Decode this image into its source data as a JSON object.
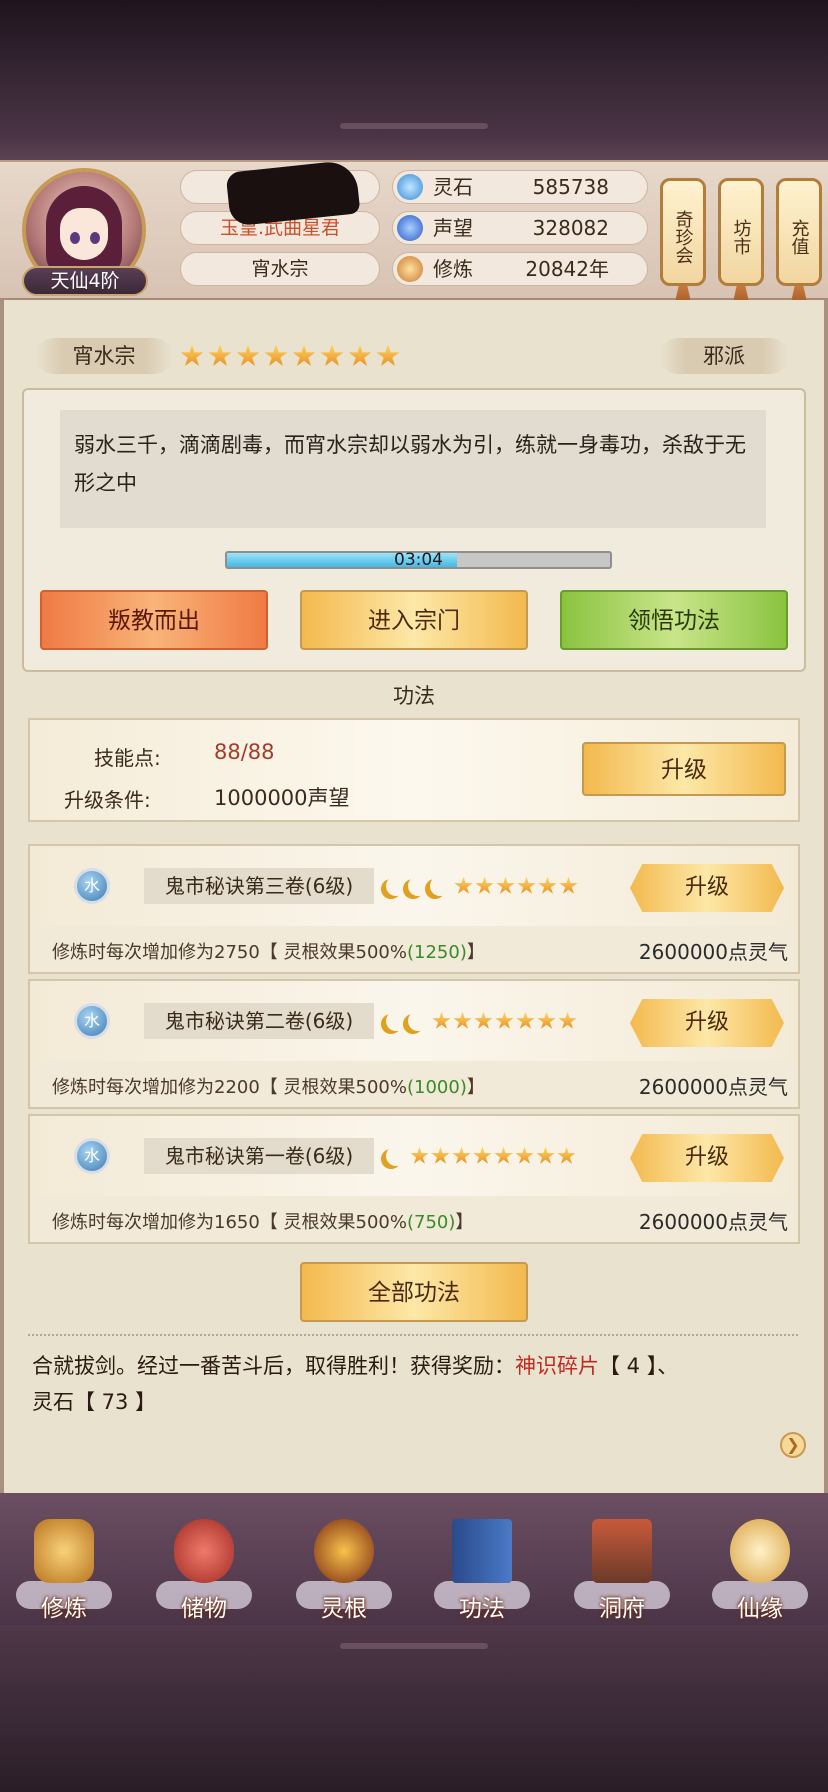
{
  "player": {
    "rank": "天仙4阶",
    "title": "玉皇.武曲星君",
    "sect": "宵水宗"
  },
  "resources": [
    {
      "icon": "spirit-stone-icon",
      "label": "灵石",
      "value": "585738",
      "color": "#5aa8e8"
    },
    {
      "icon": "reputation-icon",
      "label": "声望",
      "value": "328082",
      "color": "#3a7ad8"
    },
    {
      "icon": "cultivation-icon",
      "label": "修炼",
      "value": "20842年",
      "color": "#d89a40"
    }
  ],
  "side_buttons": [
    "奇珍会",
    "坊市",
    "充值"
  ],
  "sect_panel": {
    "name": "宵水宗",
    "stars": 8,
    "alignment": "邪派",
    "description": "弱水三千，滴滴剧毒，而宵水宗却以弱水为引，练就一身毒功，杀敌于无形之中",
    "timer": "03:04",
    "timer_progress": 0.6
  },
  "actions": {
    "leave": "叛教而出",
    "enter": "进入宗门",
    "learn": "领悟功法"
  },
  "gongfa": {
    "section_title": "功法",
    "skill_points_label": "技能点:",
    "skill_points": "88/88",
    "upgrade_cond_label": "升级条件:",
    "upgrade_cond": "1000000声望",
    "upgrade": "升级",
    "list": [
      {
        "element": "水",
        "name": "鬼市秘诀第三卷(6级)",
        "moons": 3,
        "stars": 6,
        "effect": "修炼时每次增加修为2750【 灵根效果500%",
        "bonus": "(1250)",
        "close": "】",
        "cost": "2600000点灵气",
        "upgrade": "升级"
      },
      {
        "element": "水",
        "name": "鬼市秘诀第二卷(6级)",
        "moons": 2,
        "stars": 7,
        "effect": "修炼时每次增加修为2200【 灵根效果500%",
        "bonus": "(1000)",
        "close": "】",
        "cost": "2600000点灵气",
        "upgrade": "升级"
      },
      {
        "element": "水",
        "name": "鬼市秘诀第一卷(6级)",
        "moons": 1,
        "stars": 8,
        "effect": "修炼时每次增加修为1650【 灵根效果500%",
        "bonus": "(750)",
        "close": "】",
        "cost": "2600000点灵气",
        "upgrade": "升级"
      }
    ],
    "all": "全部功法"
  },
  "log": {
    "part1": "合就拔剑。经过一番苦斗后，取得胜利！获得奖励：",
    "item1": "神识碎片",
    "item1_qty": "【 4 】、",
    "line2": "灵石【 73 】"
  },
  "nav": [
    "修炼",
    "储物",
    "灵根",
    "功法",
    "洞府",
    "仙缘"
  ]
}
